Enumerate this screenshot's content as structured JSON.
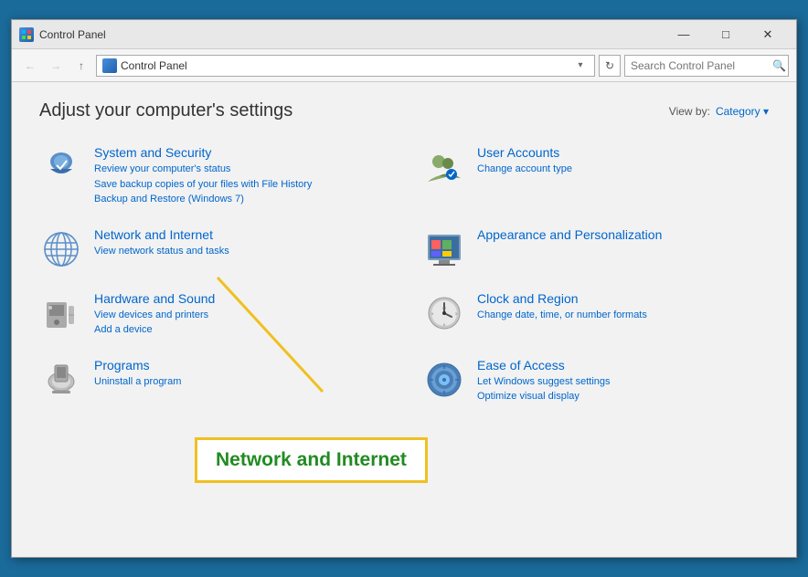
{
  "window": {
    "title": "Control Panel",
    "title_icon": "control-panel-icon"
  },
  "title_controls": {
    "minimize": "—",
    "maximize": "□",
    "close": "✕"
  },
  "address_bar": {
    "back_label": "←",
    "forward_label": "→",
    "up_label": "↑",
    "breadcrumb_text": "Control Panel",
    "dropdown_label": "▾",
    "refresh_label": "↻",
    "search_placeholder": "Search Control Panel",
    "search_icon": "🔍"
  },
  "content": {
    "title": "Adjust your computer's settings",
    "view_by_label": "View by:",
    "view_by_value": "Category",
    "items": [
      {
        "id": "system-security",
        "title": "System and Security",
        "sub": [
          "Review your computer's status",
          "Save backup copies of your files with File History",
          "Backup and Restore (Windows 7)"
        ],
        "icon_color": "#4a7fb5"
      },
      {
        "id": "user-accounts",
        "title": "User Accounts",
        "sub": [
          "Change account type"
        ],
        "icon_color": "#5a8a5a"
      },
      {
        "id": "network-internet",
        "title": "Network and Internet",
        "sub": [
          "View network status and tasks"
        ],
        "icon_color": "#4a7fb5"
      },
      {
        "id": "appearance-personalization",
        "title": "Appearance and Personalization",
        "sub": [],
        "icon_color": "#8a6a4a"
      },
      {
        "id": "hardware-sound",
        "title": "Hardware and Sound",
        "sub": [
          "View devices and printers",
          "Add a device"
        ],
        "icon_color": "#888"
      },
      {
        "id": "clock-region",
        "title": "Clock and Region",
        "sub": [
          "Change date, time, or number formats"
        ],
        "icon_color": "#888"
      },
      {
        "id": "programs",
        "title": "Programs",
        "sub": [
          "Uninstall a program"
        ],
        "icon_color": "#888"
      },
      {
        "id": "ease-of-access",
        "title": "Ease of Access",
        "sub": [
          "Let Windows suggest settings",
          "Optimize visual display"
        ],
        "icon_color": "#4a7fb5"
      }
    ]
  },
  "annotation": {
    "label": "Network and Internet",
    "border_color": "#f0c020",
    "text_color": "#228b22"
  }
}
